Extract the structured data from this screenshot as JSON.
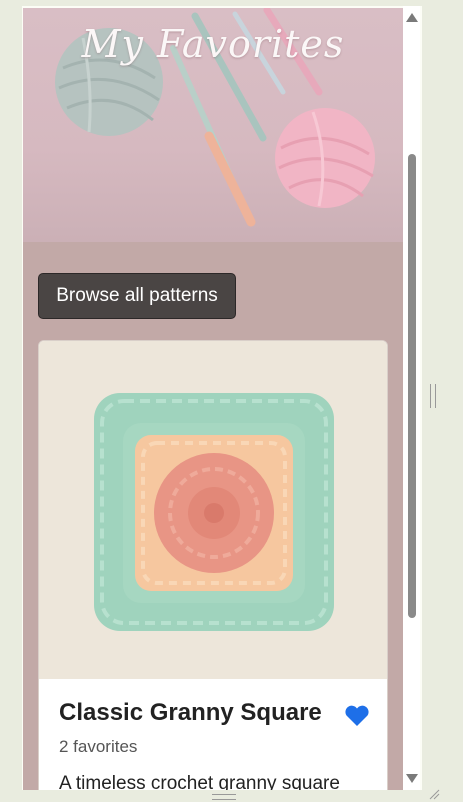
{
  "hero": {
    "title": "My Favorites",
    "background_icon": "yarn-and-crochet-hooks-image"
  },
  "actions": {
    "browse_label": "Browse all patterns"
  },
  "cards": [
    {
      "title": "Classic Granny Square",
      "favorites_text": "2 favorites",
      "description": "A timeless crochet granny square",
      "image_icon": "granny-square-image",
      "favorited": true,
      "heart_color": "#1e6fe8"
    }
  ],
  "colors": {
    "page_bg": "#c2a9a7",
    "button_bg": "#4a4544",
    "accent": "#1e6fe8"
  }
}
